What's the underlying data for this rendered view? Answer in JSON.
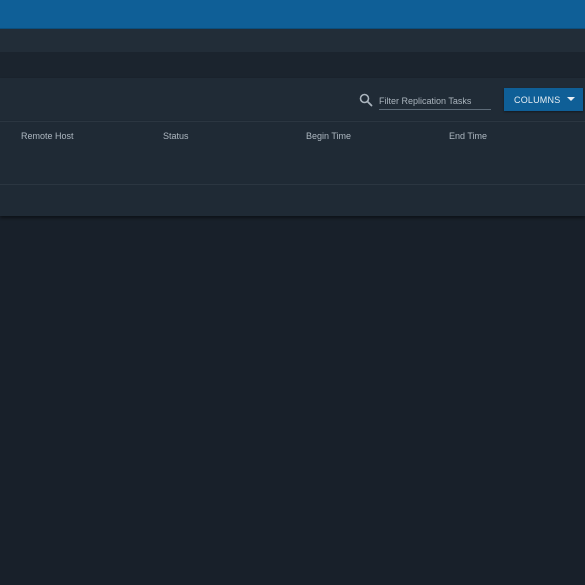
{
  "toolbar": {
    "search_placeholder": "Filter Replication Tasks",
    "columns_label": "COLUMNS"
  },
  "table": {
    "columns": [
      "Remote Host",
      "Status",
      "Begin Time",
      "End Time"
    ],
    "rows": []
  },
  "colors": {
    "accent": "#0f5f97",
    "background": "#18202a",
    "panel": "#1e2934",
    "header_text": "#aeb8c1"
  },
  "icons": {
    "search": "search-icon",
    "dropdown": "caret-down-icon"
  }
}
